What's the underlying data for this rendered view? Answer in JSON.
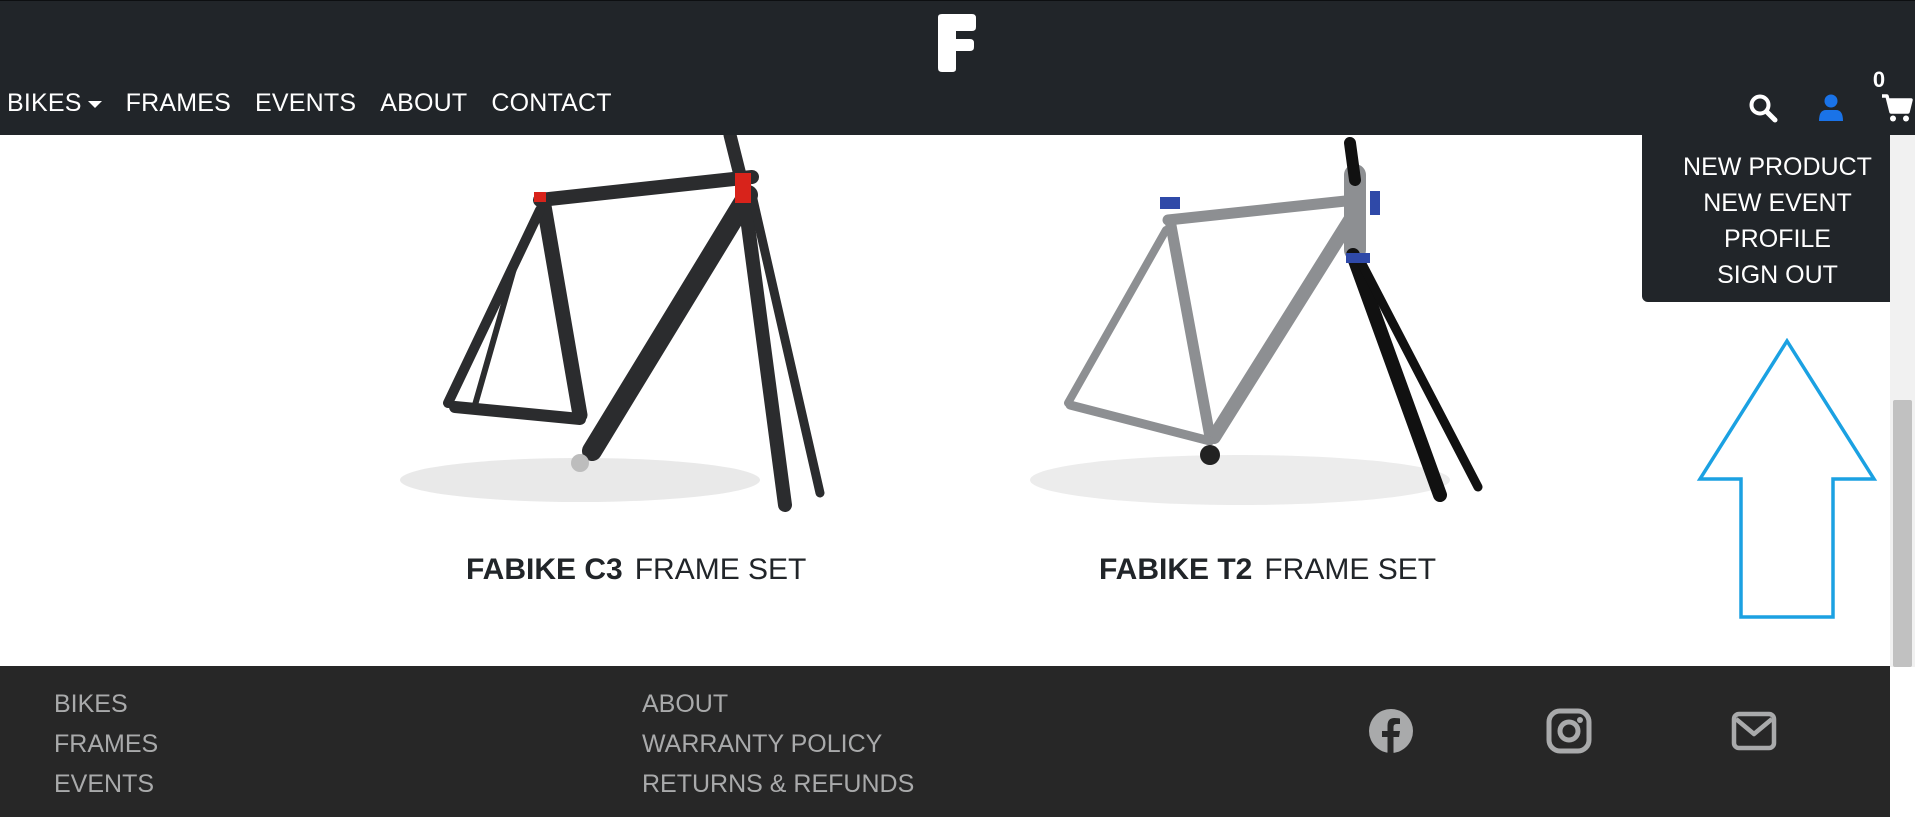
{
  "header": {
    "brand_icon": "fabike-logo-icon",
    "nav": [
      {
        "label": "BIKES",
        "has_caret": true
      },
      {
        "label": "FRAMES"
      },
      {
        "label": "EVENTS"
      },
      {
        "label": "ABOUT"
      },
      {
        "label": "CONTACT"
      }
    ],
    "icons": {
      "search": "search-icon",
      "user": "user-icon",
      "cart": "cart-icon"
    },
    "cart_count": "0",
    "user_icon_color": "#1a73e8",
    "background": "#212529"
  },
  "user_menu": {
    "items": [
      {
        "label": "NEW PRODUCT"
      },
      {
        "label": "NEW EVENT"
      },
      {
        "label": "PROFILE"
      },
      {
        "label": "SIGN OUT"
      }
    ]
  },
  "products": [
    {
      "model": "FABIKE C3",
      "suffix": "FRAME SET",
      "frame_color": "#2b2c2e",
      "accent_color": "#d8231b"
    },
    {
      "model": "FABIKE T2",
      "suffix": "FRAME SET",
      "frame_color": "#8d8f92",
      "accent_color": "#2f49a8"
    }
  ],
  "annotation": {
    "type": "arrow-up-outline",
    "color": "#1ba1e2"
  },
  "footer": {
    "col1": [
      {
        "label": "BIKES"
      },
      {
        "label": "FRAMES"
      },
      {
        "label": "EVENTS"
      }
    ],
    "col2": [
      {
        "label": "ABOUT"
      },
      {
        "label": "WARRANTY POLICY"
      },
      {
        "label": "RETURNS & REFUNDS"
      }
    ],
    "social": [
      "facebook-icon",
      "instagram-icon",
      "envelope-icon"
    ],
    "background": "#272727"
  }
}
